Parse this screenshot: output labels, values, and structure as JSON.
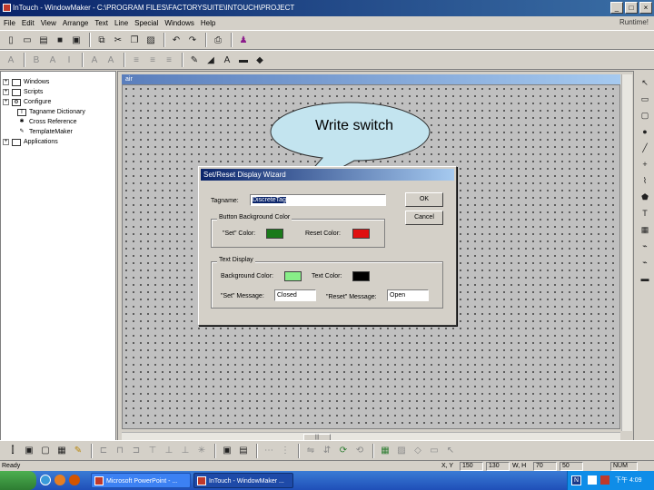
{
  "window": {
    "title": "InTouch - WindowMaker - C:\\PROGRAM FILES\\FACTORYSUITE\\INTOUCH\\PROJECT",
    "minimize": "_",
    "maximize": "□",
    "close": "×"
  },
  "menubar": {
    "items": [
      "File",
      "Edit",
      "View",
      "Arrange",
      "Text",
      "Line",
      "Special",
      "Windows",
      "Help"
    ],
    "right_label": "Runtime!"
  },
  "tree": {
    "items": [
      {
        "label": "Windows",
        "expand": "+",
        "icon": "windows-folder-icon"
      },
      {
        "label": "Scripts",
        "expand": "+",
        "icon": "scripts-icon"
      },
      {
        "label": "Configure",
        "expand": "+",
        "icon": "configure-icon"
      },
      {
        "label": "Tagname Dictionary",
        "expand": "",
        "icon": "tagname-dictionary-icon"
      },
      {
        "label": "Cross Reference",
        "expand": "",
        "icon": "cross-reference-icon"
      },
      {
        "label": "TemplateMaker",
        "expand": "",
        "icon": "templatemaker-icon"
      },
      {
        "label": "Applications",
        "expand": "+",
        "icon": "applications-icon"
      }
    ]
  },
  "document": {
    "title": "air"
  },
  "callout": {
    "text": "Write switch"
  },
  "dialog": {
    "title": "Set/Reset Display Wizard",
    "tagname_label": "Tagname:",
    "tagname_value": "DiscreteTag",
    "ok_label": "OK",
    "cancel_label": "Cancel",
    "button_bg_group_label": "Button Background Color",
    "set_color_label": "\"Set\" Color:",
    "reset_color_label": "Reset Color:",
    "text_display_group_label": "Text Display",
    "background_color_label": "Background Color:",
    "text_color_label": "Text Color:",
    "set_message_label": "\"Set\" Message:",
    "set_message_value": "Closed",
    "reset_message_label": "\"Reset\" Message:",
    "reset_message_value": "Open",
    "colors": {
      "set_color": "#1a7a1a",
      "reset_color": "#e01010",
      "background_color": "#88ee88",
      "text_color": "#000000"
    }
  },
  "statusbar": {
    "ready": "Ready",
    "xy_label": "X, Y",
    "x_value": "150",
    "y_value": "130",
    "wh_label": "W, H",
    "w_value": "70",
    "h_value": "50",
    "num": "NUM"
  },
  "taskbar": {
    "tasks": [
      {
        "label": "Microsoft PowerPoint - ...",
        "active": false
      },
      {
        "label": "InTouch - WindowMaker ...",
        "active": true
      }
    ],
    "tray_lang": "N",
    "clock": "下午 4:09"
  },
  "colors": {
    "title_bar": "#0a246a",
    "canvas": "#c0c0c0",
    "callout_fill": "#c3e4ef",
    "taskbar": "#245edb"
  }
}
